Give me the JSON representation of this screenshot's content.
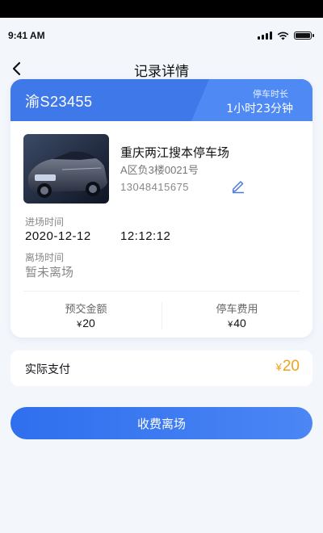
{
  "status_bar": {
    "time": "9:41 AM",
    "icons": [
      "signal-icon",
      "wifi-icon",
      "battery-icon"
    ]
  },
  "nav": {
    "title": "记录详情",
    "back_icon": "chevron-left-icon"
  },
  "record": {
    "plate": "渝S23455",
    "duration_label": "停车时长",
    "duration_value": "1小时23分钟",
    "lot_name": "重庆两江搜本停车场",
    "spot": "A区负3楼0021号",
    "phone": "13048415675",
    "edit_icon": "pencil-icon",
    "entry_label": "进场时间",
    "entry_date": "2020-12-12",
    "entry_time": "12:12:12",
    "exit_label": "离场时间",
    "exit_value": "暂未离场",
    "prepay_label": "预交金额",
    "prepay_currency": "¥",
    "prepay_amount": "20",
    "fee_label": "停车费用",
    "fee_currency": "¥",
    "fee_amount": "40"
  },
  "payment": {
    "label": "实际支付",
    "currency": "¥",
    "amount": "20"
  },
  "action": {
    "button_label": "收费离场"
  },
  "colors": {
    "primary": "#3f78e8",
    "accent": "#f0a21a",
    "background": "#f3f6fb"
  }
}
